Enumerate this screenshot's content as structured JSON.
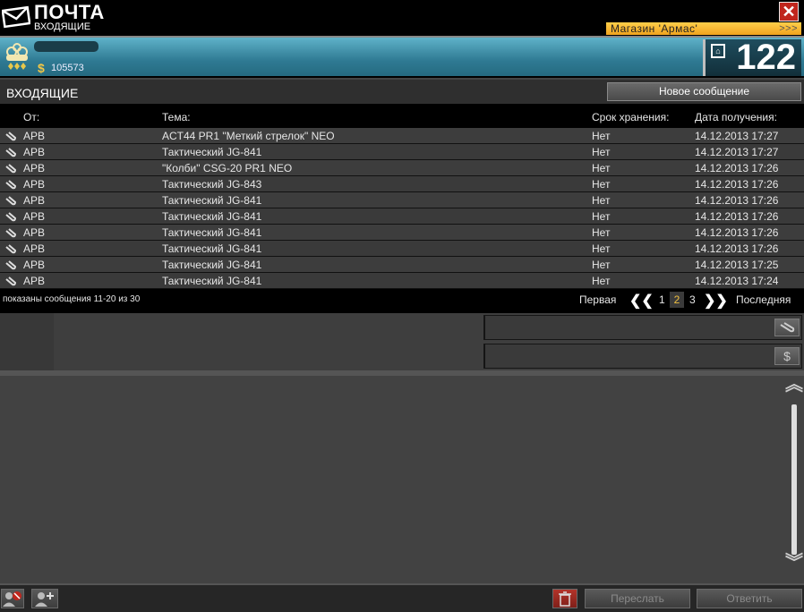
{
  "window": {
    "title": "ПОЧТА",
    "subtitle": "ВХОДЯЩИЕ",
    "close_label": "✕",
    "shop_label": "Магазин 'Армас'",
    "shop_arrows": ">>>"
  },
  "player": {
    "money": "105573",
    "money_symbol": "$",
    "level": "122"
  },
  "section": {
    "title": "ВХОДЯЩИЕ",
    "new_message_label": "Новое сообщение"
  },
  "columns": {
    "from": "От:",
    "subject": "Тема:",
    "storage": "Срок хранения:",
    "date": "Дата получения:"
  },
  "messages": [
    {
      "from": "АРВ",
      "subject": "ACT44 PR1 \"Меткий стрелок\" NEO",
      "storage": "Нет",
      "date": "14.12.2013 17:27"
    },
    {
      "from": "АРВ",
      "subject": "Тактический JG-841",
      "storage": "Нет",
      "date": "14.12.2013 17:27"
    },
    {
      "from": "АРВ",
      "subject": "\"Колби\" CSG-20 PR1 NEO",
      "storage": "Нет",
      "date": "14.12.2013 17:26"
    },
    {
      "from": "АРВ",
      "subject": "Тактический JG-843",
      "storage": "Нет",
      "date": "14.12.2013 17:26"
    },
    {
      "from": "АРВ",
      "subject": "Тактический JG-841",
      "storage": "Нет",
      "date": "14.12.2013 17:26"
    },
    {
      "from": "АРВ",
      "subject": "Тактический JG-841",
      "storage": "Нет",
      "date": "14.12.2013 17:26"
    },
    {
      "from": "АРВ",
      "subject": "Тактический JG-841",
      "storage": "Нет",
      "date": "14.12.2013 17:26"
    },
    {
      "from": "АРВ",
      "subject": "Тактический JG-841",
      "storage": "Нет",
      "date": "14.12.2013 17:26"
    },
    {
      "from": "АРВ",
      "subject": "Тактический JG-841",
      "storage": "Нет",
      "date": "14.12.2013 17:25"
    },
    {
      "from": "АРВ",
      "subject": "Тактический JG-841",
      "storage": "Нет",
      "date": "14.12.2013 17:24"
    }
  ],
  "pagination": {
    "info": "показаны сообщения 11-20 из 30",
    "first": "Первая",
    "last": "Последняя",
    "pages": [
      "1",
      "2",
      "3"
    ],
    "current": "2"
  },
  "actions": {
    "forward": "Переслать",
    "reply": "Ответить"
  },
  "colors": {
    "accent": "#f0c040",
    "player_bar": "#2f7a93",
    "close": "#c0261d"
  }
}
